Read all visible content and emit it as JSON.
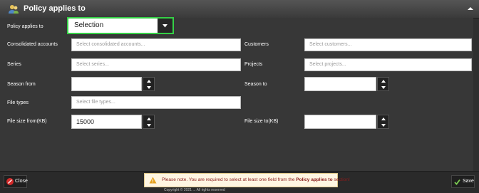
{
  "header": {
    "title": "Policy applies to",
    "logo_icon": "users-icon",
    "collapse_icon": "chevron-up-icon"
  },
  "form": {
    "policy_applies_to": {
      "label": "Policy applies to",
      "value": "Selection"
    },
    "consolidated_accounts": {
      "label": "Consolidated accounts",
      "placeholder": "Select consolidated accounts..."
    },
    "customers": {
      "label": "Customers",
      "placeholder": "Select customers..."
    },
    "series": {
      "label": "Series",
      "placeholder": "Select series..."
    },
    "projects": {
      "label": "Projects",
      "placeholder": "Select projects..."
    },
    "season_from": {
      "label": "Season from",
      "value": ""
    },
    "season_to": {
      "label": "Season to",
      "value": ""
    },
    "file_types": {
      "label": "File types",
      "placeholder": "Select file types..."
    },
    "file_size_from": {
      "label": "File size from(KB)",
      "value": "15000"
    },
    "file_size_to": {
      "label": "File size to(KB)",
      "value": ""
    }
  },
  "footer": {
    "close_label": "Close",
    "save_label": "Save",
    "notice_prefix": "Please note. You are required to select at least one field from the ",
    "notice_bold": "Policy applies to",
    "notice_suffix": " section!",
    "copyright": "Copyright © 2021 ... All rights reserved"
  },
  "colors": {
    "accent_green": "#35d046",
    "panel_bg": "#373737",
    "notice_bg": "#fff6e2",
    "notice_text": "#8a1b1b"
  }
}
